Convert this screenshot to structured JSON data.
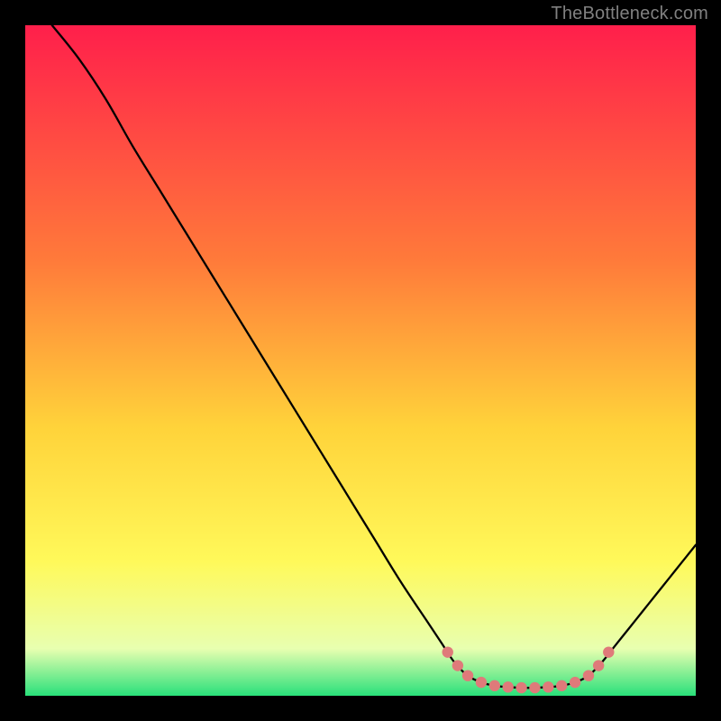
{
  "attribution": "TheBottleneck.com",
  "chart_data": {
    "type": "line",
    "title": "",
    "xlabel": "",
    "ylabel": "",
    "xlim": [
      0,
      100
    ],
    "ylim": [
      0,
      100
    ],
    "gradient_stops": [
      {
        "offset": 0,
        "color": "#ff1f4b"
      },
      {
        "offset": 35,
        "color": "#ff7a3a"
      },
      {
        "offset": 60,
        "color": "#ffd33a"
      },
      {
        "offset": 80,
        "color": "#fff95a"
      },
      {
        "offset": 93,
        "color": "#e8ffb0"
      },
      {
        "offset": 100,
        "color": "#29e07a"
      }
    ],
    "curve_points": [
      {
        "x": 4,
        "y": 100
      },
      {
        "x": 8,
        "y": 95
      },
      {
        "x": 12,
        "y": 89
      },
      {
        "x": 16,
        "y": 82
      },
      {
        "x": 20,
        "y": 75.5
      },
      {
        "x": 24,
        "y": 69
      },
      {
        "x": 28,
        "y": 62.5
      },
      {
        "x": 32,
        "y": 56
      },
      {
        "x": 36,
        "y": 49.5
      },
      {
        "x": 40,
        "y": 43
      },
      {
        "x": 44,
        "y": 36.5
      },
      {
        "x": 48,
        "y": 30
      },
      {
        "x": 52,
        "y": 23.5
      },
      {
        "x": 56,
        "y": 17
      },
      {
        "x": 60,
        "y": 11
      },
      {
        "x": 62,
        "y": 8
      },
      {
        "x": 64,
        "y": 5
      },
      {
        "x": 66,
        "y": 3
      },
      {
        "x": 68,
        "y": 2
      },
      {
        "x": 70,
        "y": 1.5
      },
      {
        "x": 72,
        "y": 1.3
      },
      {
        "x": 74,
        "y": 1.2
      },
      {
        "x": 76,
        "y": 1.2
      },
      {
        "x": 78,
        "y": 1.3
      },
      {
        "x": 80,
        "y": 1.5
      },
      {
        "x": 82,
        "y": 2
      },
      {
        "x": 84,
        "y": 3
      },
      {
        "x": 86,
        "y": 5
      },
      {
        "x": 88,
        "y": 7.5
      },
      {
        "x": 90,
        "y": 10
      },
      {
        "x": 92,
        "y": 12.5
      },
      {
        "x": 94,
        "y": 15
      },
      {
        "x": 96,
        "y": 17.5
      },
      {
        "x": 98,
        "y": 20
      },
      {
        "x": 100,
        "y": 22.5
      }
    ],
    "markers": [
      {
        "x": 63,
        "y": 6.5
      },
      {
        "x": 64.5,
        "y": 4.5
      },
      {
        "x": 66,
        "y": 3
      },
      {
        "x": 68,
        "y": 2
      },
      {
        "x": 70,
        "y": 1.5
      },
      {
        "x": 72,
        "y": 1.3
      },
      {
        "x": 74,
        "y": 1.2
      },
      {
        "x": 76,
        "y": 1.2
      },
      {
        "x": 78,
        "y": 1.3
      },
      {
        "x": 80,
        "y": 1.5
      },
      {
        "x": 82,
        "y": 2
      },
      {
        "x": 84,
        "y": 3
      },
      {
        "x": 85.5,
        "y": 4.5
      },
      {
        "x": 87,
        "y": 6.5
      }
    ]
  }
}
